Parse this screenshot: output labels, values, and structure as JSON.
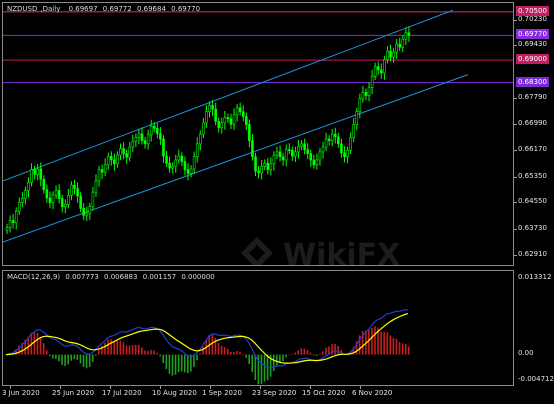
{
  "symbol": "NZDUSD",
  "timeframe": "Daily",
  "ohlc": {
    "open": "0.69697",
    "high": "0.69772",
    "low": "0.69684",
    "close": "0.69770"
  },
  "watermark_text": "WikiFX",
  "price_axis": [
    "0.70230",
    "0.69430",
    "0.67790",
    "0.66990",
    "0.66170",
    "0.65350",
    "0.64550",
    "0.63730",
    "0.62910"
  ],
  "levels": [
    {
      "price": "0.70500",
      "color": "#c01e60",
      "line": "#d2328c"
    },
    {
      "price": "0.69770",
      "color": "#8a2be2",
      "line": "#8a2be2"
    },
    {
      "price": "0.69000",
      "color": "#c01e60",
      "line": "#c01e60"
    },
    {
      "price": "0.68300",
      "color": "#7b2bd6",
      "line": "#8a2be2"
    }
  ],
  "macd": {
    "label": "MACD(12,26,9)",
    "values": [
      "0.007773",
      "0.006883",
      "0.001157",
      "0.000000"
    ],
    "axis": [
      "0.013312",
      "0.00",
      "-0.004712"
    ]
  },
  "time_axis": [
    "3 Jun 2020",
    "25 Jun 2020",
    "17 Jul 2020",
    "10 Aug 2020",
    "1 Sep 2020",
    "23 Sep 2020",
    "15 Oct 2020",
    "6 Nov 2020"
  ],
  "colors": {
    "bull": "#00ff00",
    "bear": "#00ff00",
    "channel": "#1e90d6",
    "macd_line": "#1e3fd0",
    "signal_line": "#ffff00",
    "osma_pos": "#c81e1e",
    "osma_neg": "#1fa01f"
  },
  "price_series": [
    0.638,
    0.6402,
    0.6395,
    0.6431,
    0.6458,
    0.647,
    0.6495,
    0.652,
    0.656,
    0.6545,
    0.6562,
    0.653,
    0.6498,
    0.6472,
    0.6458,
    0.6481,
    0.6495,
    0.647,
    0.6445,
    0.6452,
    0.648,
    0.6512,
    0.6501,
    0.6478,
    0.644,
    0.6418,
    0.6425,
    0.6445,
    0.649,
    0.6525,
    0.656,
    0.6552,
    0.6575,
    0.6601,
    0.659,
    0.6578,
    0.6605,
    0.6625,
    0.661,
    0.6598,
    0.663,
    0.6648,
    0.666,
    0.6671,
    0.665,
    0.664,
    0.6668,
    0.6695,
    0.6688,
    0.6672,
    0.6655,
    0.6602,
    0.658,
    0.6565,
    0.6571,
    0.659,
    0.6602,
    0.6585,
    0.656,
    0.6548,
    0.6562,
    0.66,
    0.664,
    0.667,
    0.6705,
    0.674,
    0.676,
    0.6748,
    0.671,
    0.669,
    0.6705,
    0.6722,
    0.6718,
    0.6701,
    0.673,
    0.6752,
    0.674,
    0.6725,
    0.67,
    0.665,
    0.66,
    0.6555,
    0.655,
    0.657,
    0.658,
    0.656,
    0.6578,
    0.6605,
    0.6615,
    0.66,
    0.659,
    0.6622,
    0.662,
    0.6602,
    0.6615,
    0.6632,
    0.664,
    0.6622,
    0.661,
    0.659,
    0.6575,
    0.659,
    0.6615,
    0.663,
    0.6655,
    0.665,
    0.667,
    0.6662,
    0.664,
    0.6612,
    0.66,
    0.662,
    0.666,
    0.67,
    0.674,
    0.678,
    0.68,
    0.679,
    0.6815,
    0.685,
    0.688,
    0.687,
    0.686,
    0.6902,
    0.6928,
    0.691,
    0.6925,
    0.695,
    0.694,
    0.6965,
    0.6985,
    0.6977
  ]
}
